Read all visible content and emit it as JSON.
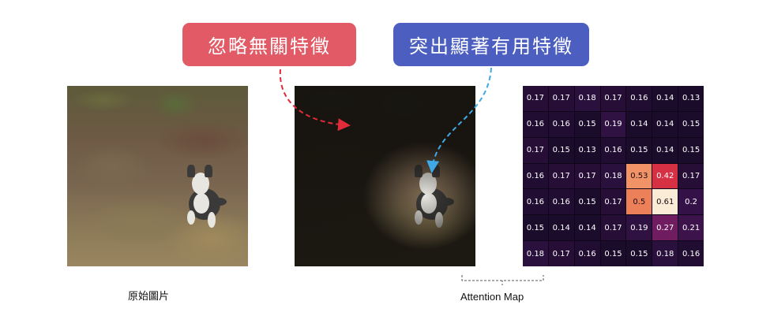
{
  "callouts": {
    "ignore_label": "忽略無關特徵",
    "highlight_label": "突出顯著有用特徵"
  },
  "captions": {
    "original": "原始圖片",
    "attention": "Attention Map"
  },
  "colors": {
    "ignore": "#e15a66",
    "highlight": "#4c5fc1",
    "ignore_arrow": "#e02b3a",
    "highlight_arrow": "#3fa9e8"
  },
  "attention_map": {
    "rows": [
      [
        "0.17",
        "0.17",
        "0.18",
        "0.17",
        "0.16",
        "0.14",
        "0.13"
      ],
      [
        "0.16",
        "0.16",
        "0.15",
        "0.19",
        "0.14",
        "0.14",
        "0.15"
      ],
      [
        "0.17",
        "0.15",
        "0.13",
        "0.16",
        "0.15",
        "0.14",
        "0.15"
      ],
      [
        "0.16",
        "0.17",
        "0.17",
        "0.18",
        "0.53",
        "0.42",
        "0.17"
      ],
      [
        "0.16",
        "0.16",
        "0.15",
        "0.17",
        "0.5",
        "0.61",
        "0.2"
      ],
      [
        "0.15",
        "0.14",
        "0.14",
        "0.17",
        "0.19",
        "0.27",
        "0.21"
      ],
      [
        "0.18",
        "0.17",
        "0.16",
        "0.15",
        "0.15",
        "0.18",
        "0.16"
      ]
    ]
  }
}
